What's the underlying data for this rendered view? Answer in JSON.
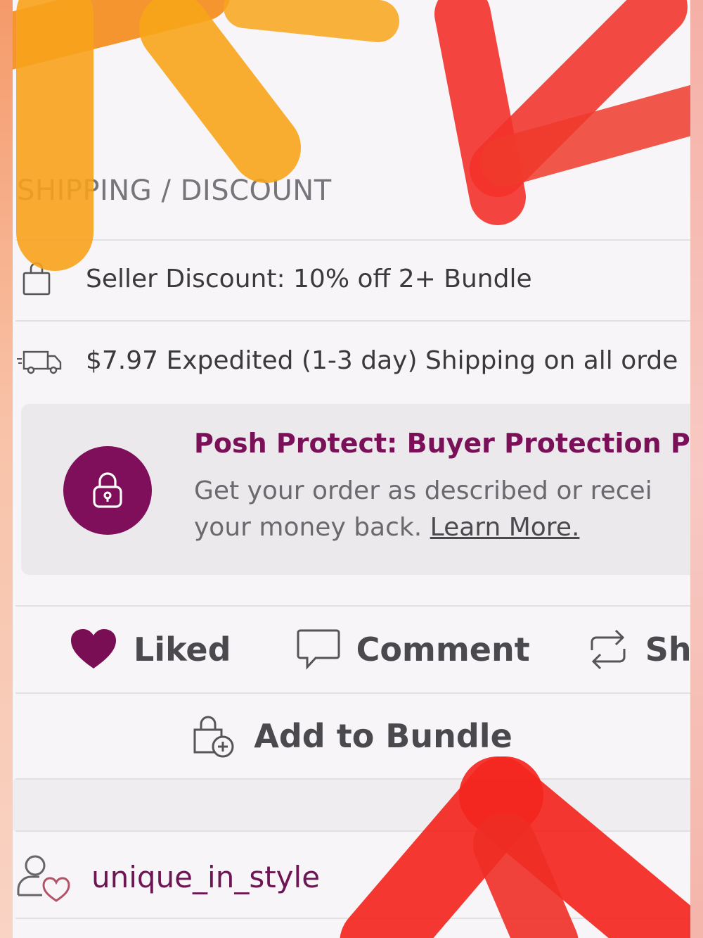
{
  "section": {
    "title": "SHIPPING / DISCOUNT"
  },
  "discount": {
    "icon": "shopping-bag-icon",
    "text": "Seller Discount: 10% off 2+ Bundle"
  },
  "shipping": {
    "icon": "truck-icon",
    "text": "$7.97 Expedited (1-3 day) Shipping on all orde"
  },
  "protect": {
    "icon": "lock-icon",
    "title": "Posh Protect: Buyer Protection Po",
    "body_line1": "Get your order as described or recei",
    "body_line2": "your money back.",
    "learn_more": "Learn More."
  },
  "actions": {
    "liked_label": "Liked",
    "comment_label": "Comment",
    "share_label": "Sha"
  },
  "bundle": {
    "label": "Add to Bundle"
  },
  "seller": {
    "username": "unique_in_style"
  },
  "colors": {
    "brand": "#7f0f5a",
    "text_primary": "#3a3a3c",
    "text_muted": "#75757a",
    "card_bg": "#ebe9ec"
  }
}
